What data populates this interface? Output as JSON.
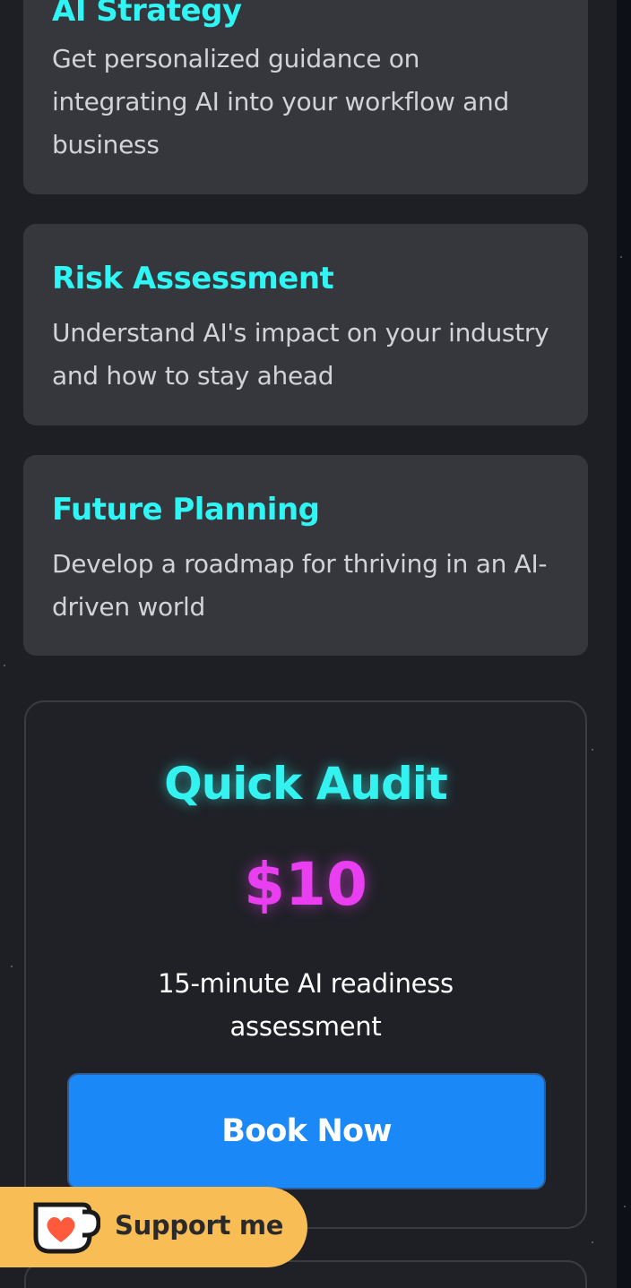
{
  "cards": [
    {
      "title": "AI Strategy",
      "description": "Get personalized guidance on integrating AI into your workflow and business"
    },
    {
      "title": "Risk Assessment",
      "description": "Understand AI's impact on your industry and how to stay ahead"
    },
    {
      "title": "Future Planning",
      "description": "Develop a roadmap for thriving in an AI-driven world"
    }
  ],
  "pricing": {
    "title": "Quick Audit",
    "price": "$10",
    "description": "15-minute AI readiness assessment",
    "button_label": "Book Now"
  },
  "support_widget": {
    "label": "Support me",
    "icon": "ko-fi-cup-heart-icon"
  },
  "colors": {
    "accent_cyan": "#2ff6f4",
    "accent_magenta": "#ea3ff0",
    "button_blue": "#1b88f7",
    "support_yellow": "#f9bd55"
  }
}
